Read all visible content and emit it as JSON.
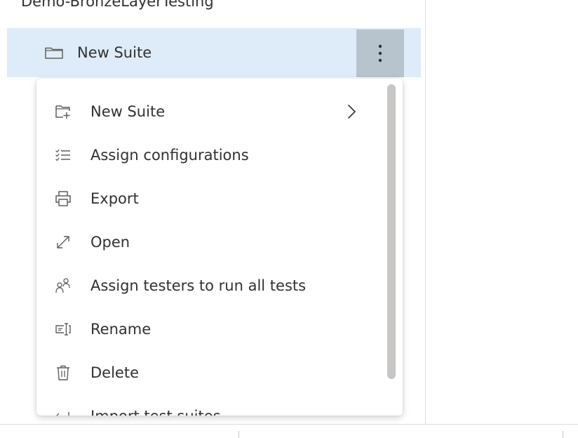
{
  "tree": {
    "parent_label": "Demo-BronzeLayerTesting",
    "selected_suite": {
      "label": "New Suite",
      "icon": "folder-icon",
      "more_icon": "more-vertical-icon"
    }
  },
  "context_menu": {
    "items": [
      {
        "label": "New Suite",
        "icon": "new-suite-icon",
        "has_submenu": true
      },
      {
        "label": "Assign configurations",
        "icon": "assign-configurations-icon"
      },
      {
        "label": "Export",
        "icon": "print-icon"
      },
      {
        "label": "Open",
        "icon": "expand-diagonal-icon"
      },
      {
        "label": "Assign testers to run all tests",
        "icon": "people-icon"
      },
      {
        "label": "Rename",
        "icon": "rename-icon"
      },
      {
        "label": "Delete",
        "icon": "trash-icon"
      },
      {
        "label": "Import test suites",
        "icon": "import-icon"
      }
    ]
  },
  "colors": {
    "selected_row": "#deecf9",
    "more_button": "#b7c3cd",
    "text": "#323130",
    "icon": "#605e5c"
  }
}
